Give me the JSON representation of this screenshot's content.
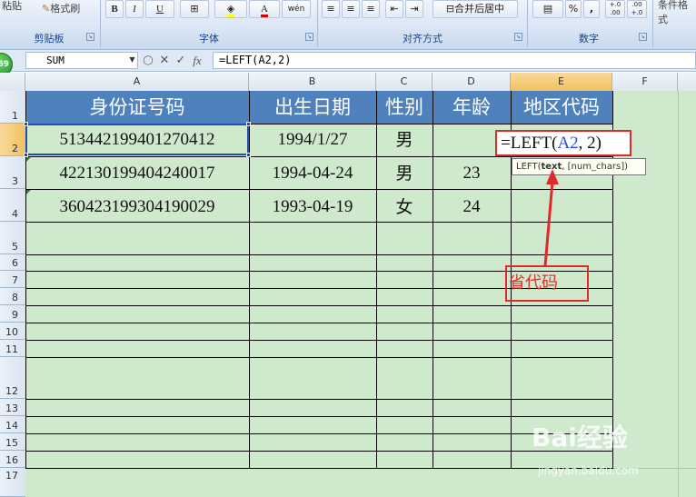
{
  "ribbon": {
    "paste_label": "粘贴",
    "format_painter_label": "格式刷",
    "bold_label": "B",
    "italic_label": "I",
    "underline_label": "U",
    "font_color_label": "A",
    "phonetic_label": "wén",
    "merge_center_label": "合并后居中",
    "percent_label": "%",
    "comma_label": ",",
    "decimal_inc_label": "+.0 .00",
    "decimal_dec_label": ".00 +.0",
    "conditional_label": "条件格式",
    "groups": {
      "clipboard": "剪贴板",
      "font": "字体",
      "alignment": "对齐方式",
      "number": "数字"
    }
  },
  "formula_bar": {
    "name_box": "SUM",
    "formula": "=LEFT(A2,2)",
    "cancel_symbol": "✕",
    "enter_symbol": "✓",
    "fx_symbol": "fx",
    "badge_text": "69"
  },
  "columns": [
    "A",
    "B",
    "C",
    "D",
    "E",
    "F"
  ],
  "rows": [
    "1",
    "2",
    "3",
    "4",
    "5",
    "6",
    "7",
    "8",
    "9",
    "10",
    "11",
    "12",
    "13",
    "14",
    "15",
    "16",
    "17"
  ],
  "table": {
    "headers": [
      "身份证号码",
      "出生日期",
      "性别",
      "年龄",
      "地区代码"
    ],
    "rows": [
      [
        "513442199401270412",
        "1994/1/27",
        "男",
        "",
        ""
      ],
      [
        "422130199404240017",
        "1994-04-24",
        "男",
        "23",
        ""
      ],
      [
        "360423199304190029",
        "1993-04-19",
        "女",
        "24",
        ""
      ]
    ]
  },
  "active_cell": {
    "prefix": "=LEFT(",
    "ref": "A2",
    "suffix": ", 2)"
  },
  "tooltip": {
    "fn": "LEFT(",
    "arg_bold": "text",
    "rest": ", [num_chars])"
  },
  "annotation": {
    "label": "省代码"
  },
  "watermark": {
    "brand": "Bai经验",
    "url": "jingyan.baidu.com"
  },
  "colors": {
    "header_fill": "#4f81bd",
    "cell_fill": "#cfe9cd",
    "annotation_red": "#e02a2a",
    "reference_blue": "#2b4fd6"
  }
}
